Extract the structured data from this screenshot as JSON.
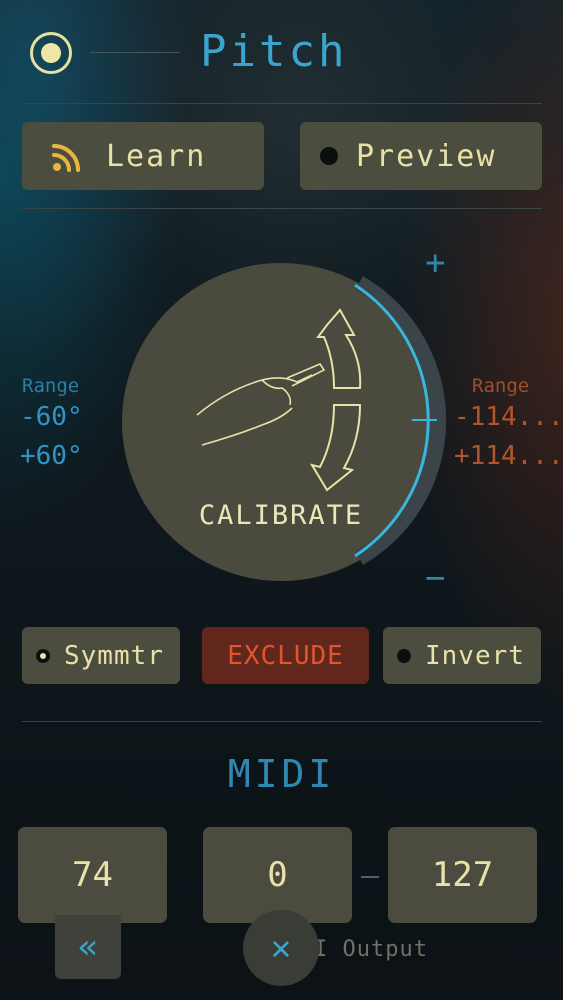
{
  "header": {
    "title": "Pitch"
  },
  "buttons": {
    "learn": "Learn",
    "preview": "Preview"
  },
  "dial": {
    "calibrate_label": "CALIBRATE",
    "plus": "+",
    "minus": "−"
  },
  "range_left": {
    "label": "Range",
    "min": "-60°",
    "max": "+60°"
  },
  "range_right": {
    "label": "Range",
    "min": "-114...",
    "max": "+114..."
  },
  "options": {
    "symmetric": "Symmtr",
    "exclude": "EXCLUDE",
    "invert": "Invert"
  },
  "midi": {
    "title": "MIDI",
    "cc": "74",
    "low": "0",
    "high": "127",
    "output_label": "I Output"
  },
  "nav": {
    "back": "«",
    "close": "✕"
  },
  "colors": {
    "accent_blue": "#3aa5cf",
    "accent_orange": "#b0552c",
    "button_bg": "#4b4d3f",
    "text_yellow": "#e8e2a8",
    "exclude_bg": "#61271c"
  },
  "icons": [
    "power-toggle-icon",
    "rss-feed-icon",
    "hand-wand-icon",
    "rotate-arrows-icon"
  ]
}
